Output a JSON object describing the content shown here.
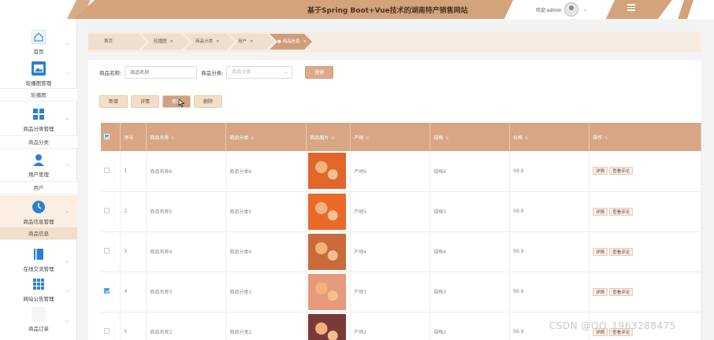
{
  "header": {
    "title": "基于Spring Boot+Vue技术的湖南特产销售网站",
    "user_greeting": "欢迎 admin",
    "chevron": "⌄"
  },
  "sidebar": {
    "items": [
      {
        "label": "首页",
        "icon": "home-icon"
      },
      {
        "label": "轮播图管理",
        "icon": "image-icon"
      },
      {
        "label": "商品分类管理",
        "icon": "grid-icon"
      },
      {
        "label": "用户管理",
        "icon": "user-icon"
      },
      {
        "label": "商品信息管理",
        "icon": "clock-icon"
      },
      {
        "label": "在线交流管理",
        "icon": "book-icon"
      },
      {
        "label": "网站公告管理",
        "icon": "apps-icon"
      },
      {
        "label": "商品订单",
        "icon": "order-icon"
      }
    ],
    "submenus": {
      "carousel": "轮播图",
      "category": "商品分类",
      "user": "用户",
      "product": "商品信息"
    }
  },
  "breadcrumb": [
    {
      "label": "首页",
      "closable": false
    },
    {
      "label": "轮播图",
      "closable": true
    },
    {
      "label": "商品分类",
      "closable": true
    },
    {
      "label": "用户",
      "closable": true
    },
    {
      "label": "● 商品信息",
      "closable": true,
      "active": true
    }
  ],
  "search": {
    "name_label": "商品名称:",
    "name_placeholder": "商品名称",
    "category_label": "商品分类:",
    "category_placeholder": "商品分类",
    "search_button": "搜索"
  },
  "actions": {
    "add": "新增",
    "detail": "详情",
    "edit": "修改",
    "delete": "删除"
  },
  "table": {
    "headers": [
      "序号",
      "商品名称",
      "商品分类",
      "商品图片",
      "产地",
      "规格",
      "价格",
      "操作"
    ],
    "rows": [
      {
        "index": "1",
        "name": "商品名称6",
        "category": "商品分类6",
        "origin": "产地6",
        "spec": "规格6",
        "price": "99.9",
        "checked": false,
        "img_color": "#e0662c"
      },
      {
        "index": "2",
        "name": "商品名称5",
        "category": "商品分类5",
        "origin": "产地5",
        "spec": "规格5",
        "price": "99.9",
        "checked": false,
        "img_color": "#e86a2a"
      },
      {
        "index": "3",
        "name": "商品名称4",
        "category": "商品分类4",
        "origin": "产地4",
        "spec": "规格4",
        "price": "99.9",
        "checked": false,
        "img_color": "#c96b3a"
      },
      {
        "index": "4",
        "name": "商品名称3",
        "category": "商品分类3",
        "origin": "产地3",
        "spec": "规格3",
        "price": "99.9",
        "checked": true,
        "img_color": "#e69a7c"
      },
      {
        "index": "5",
        "name": "商品名称2",
        "category": "商品分类2",
        "origin": "产地2",
        "spec": "规格2",
        "price": "99.9",
        "checked": false,
        "img_color": "#7a3a38"
      }
    ],
    "op_detail": "详情",
    "op_review": "查看评论"
  },
  "watermark": "CSDN @QQ_1963288475",
  "colors": {
    "accent": "#d3a37b",
    "header_cell": "#d8a685",
    "checkbox": "#4aa3df"
  }
}
